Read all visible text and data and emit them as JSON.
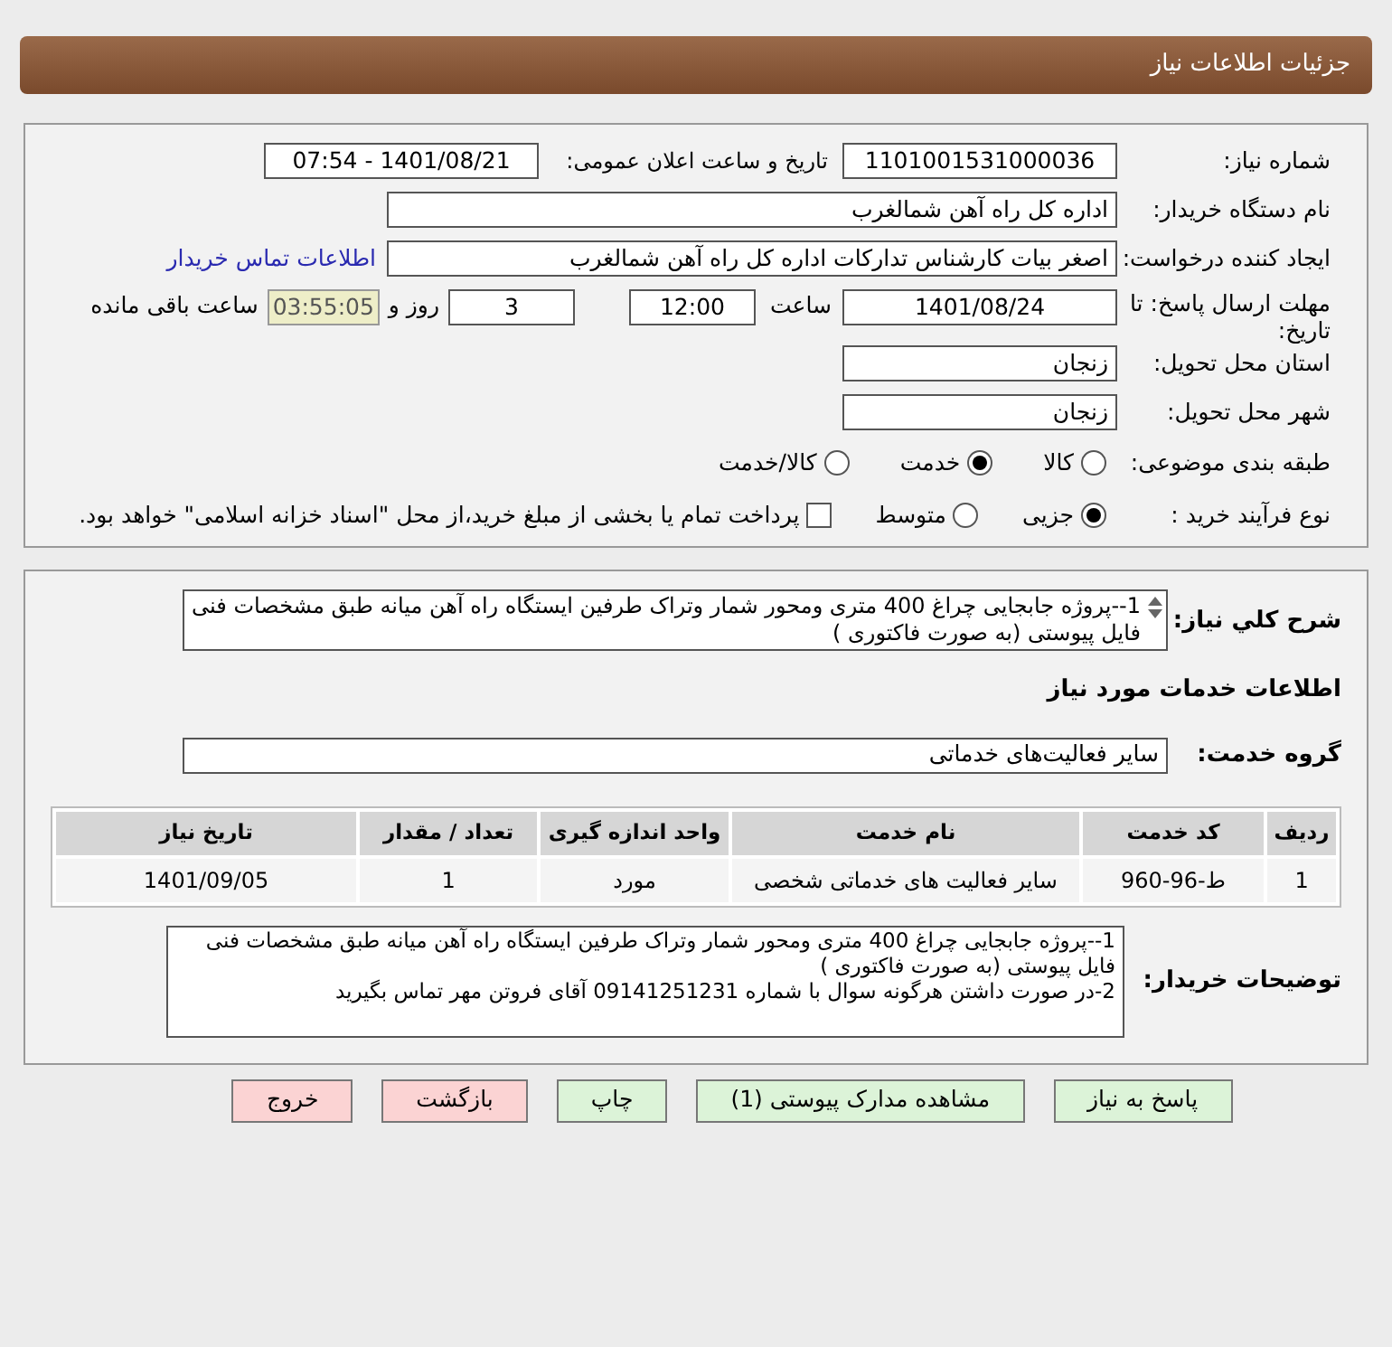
{
  "header": {
    "title": "جزئیات اطلاعات نیاز"
  },
  "details": {
    "need_number": {
      "label": "شماره نیاز:",
      "value": "1101001531000036"
    },
    "announce": {
      "label": "تاریخ و ساعت اعلان عمومی:",
      "value": "1401/08/21 - 07:54"
    },
    "buyer": {
      "label": "نام دستگاه خریدار:",
      "value": "اداره کل راه آهن شمالغرب"
    },
    "creator": {
      "label": "ایجاد کننده درخواست:",
      "value": "اصغر بیات کارشناس تدارکات اداره کل راه آهن شمالغرب",
      "link": "اطلاعات تماس خریدار"
    },
    "deadline": {
      "label": "مهلت ارسال پاسخ: تا تاریخ:",
      "date": "1401/08/24",
      "time_label": "ساعت",
      "time": "12:00",
      "days": "3",
      "days_label": "روز و",
      "remaining": "03:55:05",
      "remaining_label": "ساعت باقی مانده"
    },
    "province": {
      "label": "استان محل تحویل:",
      "value": "زنجان"
    },
    "city": {
      "label": "شهر محل تحویل:",
      "value": "زنجان"
    },
    "category": {
      "label": "طبقه بندی موضوعی:",
      "options": [
        {
          "label": "کالا",
          "selected": false
        },
        {
          "label": "خدمت",
          "selected": true
        },
        {
          "label": "کالا/خدمت",
          "selected": false
        }
      ]
    },
    "process": {
      "label": "نوع فرآیند خرید :",
      "options": [
        {
          "kind": "radio",
          "label": "جزیی",
          "selected": true
        },
        {
          "kind": "radio",
          "label": "متوسط",
          "selected": false
        },
        {
          "kind": "checkbox",
          "label": "پرداخت تمام یا بخشی از مبلغ خرید،از محل \"اسناد خزانه اسلامی\" خواهد بود.",
          "selected": false
        }
      ]
    }
  },
  "needs": {
    "summary_label": "شرح کلي نیاز:",
    "summary": "1--پروژه جابجایی چراغ 400 متری ومحور شمار وتراک طرفین ایستگاه راه آهن میانه طبق مشخصات فنی فایل پیوستی (به صورت فاکتوری )",
    "section_title": "اطلاعات خدمات مورد نیاز",
    "group_label": "گروه خدمت:",
    "group": "سایر فعالیت‌های خدماتی",
    "table": {
      "columns": [
        "ردیف",
        "کد خدمت",
        "نام خدمت",
        "واحد اندازه گیری",
        "تعداد / مقدار",
        "تاریخ نیاز"
      ],
      "rows": [
        [
          "1",
          "ط-96-960",
          "سایر فعالیت های خدماتی شخصی",
          "مورد",
          "1",
          "1401/09/05"
        ]
      ]
    },
    "buyer_notes_label": "توضیحات خریدار:",
    "buyer_notes": [
      "1--پروژه جابجایی چراغ 400 متری ومحور شمار وتراک طرفین ایستگاه راه آهن میانه طبق مشخصات فنی فایل پیوستی (به صورت فاکتوری )",
      "2-در صورت داشتن هرگونه سوال با شماره 09141251231 آقای فروتن مهر تماس بگیرید"
    ]
  },
  "buttons": [
    {
      "label": "پاسخ به نیاز",
      "kind": "primary"
    },
    {
      "label": "مشاهده مدارک پیوستی (1)",
      "kind": "primary"
    },
    {
      "label": "چاپ",
      "kind": "primary"
    },
    {
      "label": "بازگشت",
      "kind": "danger"
    },
    {
      "label": "خروج",
      "kind": "danger"
    }
  ]
}
